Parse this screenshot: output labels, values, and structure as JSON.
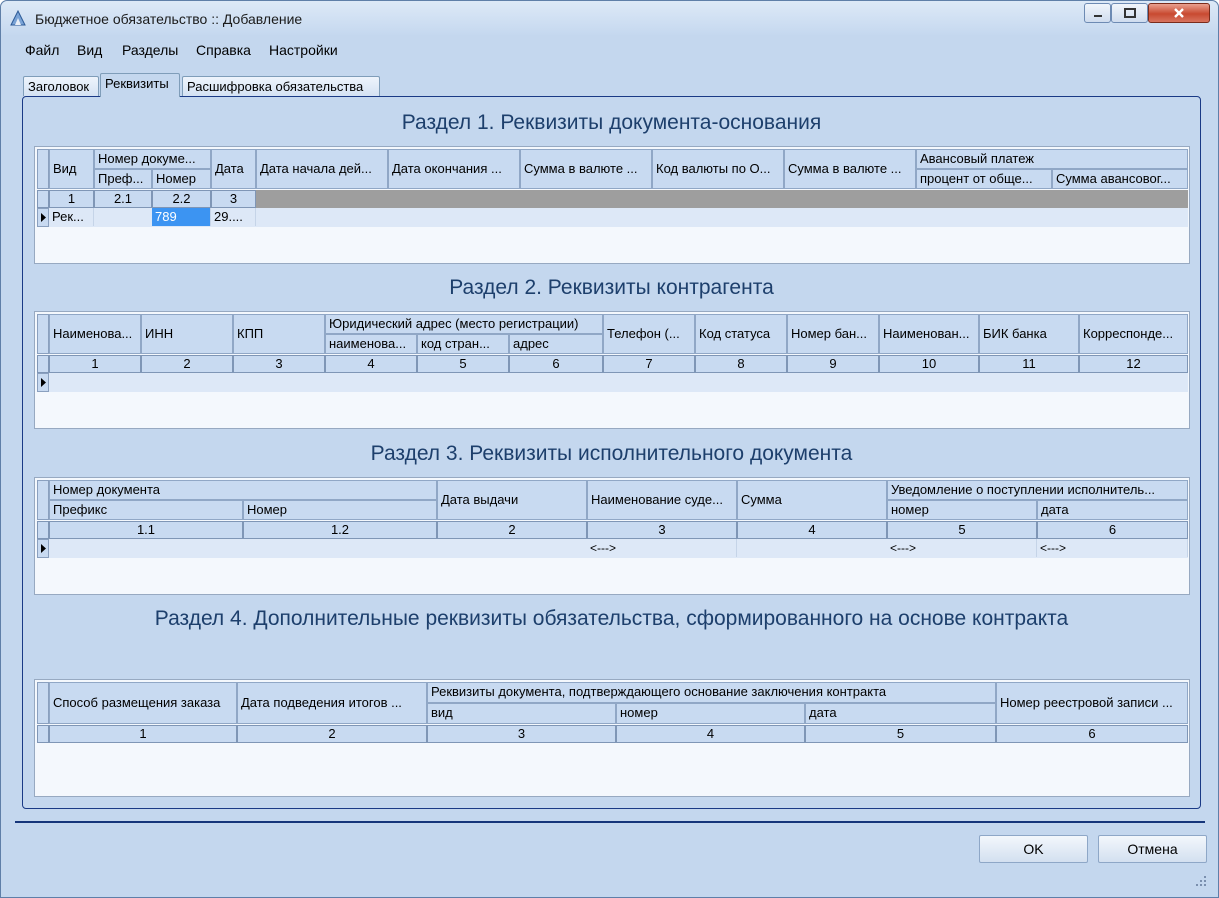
{
  "window": {
    "title": "Бюджетное обязательство :: Добавление"
  },
  "menu": [
    "Файл",
    "Вид",
    "Разделы",
    "Справка",
    "Настройки"
  ],
  "tabs": [
    "Заголовок",
    "Реквизиты",
    "Расшифровка обязательства"
  ],
  "s1": {
    "title": "Раздел 1. Реквизиты документа-основания",
    "h": {
      "vid": "Вид",
      "nomer_group": "Номер докуме...",
      "pref": "Преф...",
      "nomer": "Номер",
      "data": "Дата",
      "d_start": "Дата начала дей...",
      "d_end": "Дата окончания ...",
      "sum_val": "Сумма в валюте ...",
      "kod_val": "Код валюты по О...",
      "sum_val2": "Сумма в валюте ...",
      "avans": "Авансовый платеж",
      "proc": "процент от обще...",
      "sum_av": "Сумма авансовог..."
    },
    "nums": {
      "vid": "1",
      "pref": "2.1",
      "nomer": "2.2",
      "data": "3"
    },
    "row": {
      "vid": "Рек...",
      "nomer": "789",
      "data": "29...."
    }
  },
  "s2": {
    "title": "Раздел 2. Реквизиты контрагента",
    "h": {
      "name": "Наименова...",
      "inn": "ИНН",
      "kpp": "КПП",
      "addr_group": "Юридический адрес (место регистрации)",
      "addr_name": "наименова...",
      "addr_code": "код стран...",
      "addr": "адрес",
      "tel": "Телефон (...",
      "status": "Код статуса",
      "bank_num": "Номер бан...",
      "bank_name": "Наименован...",
      "bik": "БИК банка",
      "corr": "Корреспонде..."
    },
    "nums": [
      "1",
      "2",
      "3",
      "4",
      "5",
      "6",
      "7",
      "8",
      "9",
      "10",
      "11",
      "12"
    ]
  },
  "s3": {
    "title": "Раздел 3. Реквизиты исполнительного документа",
    "h": {
      "num_group": "Номер документа",
      "pref": "Префикс",
      "nomer": "Номер",
      "date": "Дата выдачи",
      "court": "Наименование суде...",
      "sum": "Сумма",
      "notice": "Уведомление о поступлении исполнитель...",
      "n_num": "номер",
      "n_date": "дата"
    },
    "nums": [
      "1.1",
      "1.2",
      "2",
      "3",
      "4",
      "5",
      "6"
    ],
    "row": {
      "court": "<--->",
      "n_num": "<--->",
      "n_date": "<--->"
    }
  },
  "s4": {
    "title": "Раздел 4. Дополнительные реквизиты обязательства, сформированного на основе контракта",
    "h": {
      "method": "Способ размещения заказа",
      "date": "Дата подведения итогов ...",
      "req_group": "Реквизиты документа, подтверждающего основание заключения контракта",
      "vid": "вид",
      "nomer": "номер",
      "data": "дата",
      "reg": "Номер реестровой записи ..."
    },
    "nums": [
      "1",
      "2",
      "3",
      "4",
      "5",
      "6"
    ]
  },
  "buttons": {
    "ok": "OK",
    "cancel": "Отмена"
  }
}
